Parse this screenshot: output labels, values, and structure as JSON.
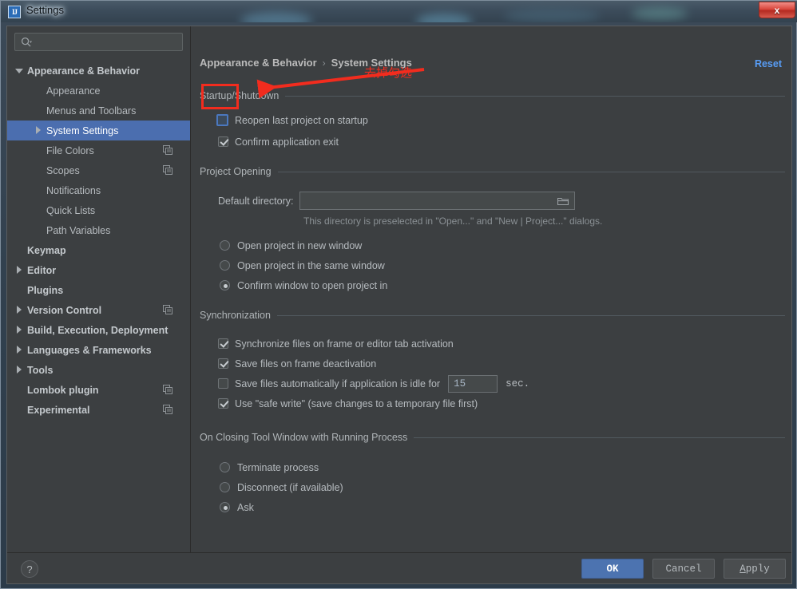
{
  "window": {
    "title": "Settings",
    "app_icon": "intellij-idea-icon",
    "close_label": "x"
  },
  "sidebar": {
    "search": {
      "value": "",
      "placeholder": ""
    },
    "items": [
      {
        "label": "Appearance & Behavior",
        "indent": 0,
        "twisty": "down",
        "bold": true,
        "selected": false,
        "copy": false
      },
      {
        "label": "Appearance",
        "indent": 1,
        "twisty": "none",
        "bold": false,
        "selected": false,
        "copy": false
      },
      {
        "label": "Menus and Toolbars",
        "indent": 1,
        "twisty": "none",
        "bold": false,
        "selected": false,
        "copy": false
      },
      {
        "label": "System Settings",
        "indent": 1,
        "twisty": "right",
        "bold": false,
        "selected": true,
        "copy": false
      },
      {
        "label": "File Colors",
        "indent": 1,
        "twisty": "none",
        "bold": false,
        "selected": false,
        "copy": true
      },
      {
        "label": "Scopes",
        "indent": 1,
        "twisty": "none",
        "bold": false,
        "selected": false,
        "copy": true
      },
      {
        "label": "Notifications",
        "indent": 1,
        "twisty": "none",
        "bold": false,
        "selected": false,
        "copy": false
      },
      {
        "label": "Quick Lists",
        "indent": 1,
        "twisty": "none",
        "bold": false,
        "selected": false,
        "copy": false
      },
      {
        "label": "Path Variables",
        "indent": 1,
        "twisty": "none",
        "bold": false,
        "selected": false,
        "copy": false
      },
      {
        "label": "Keymap",
        "indent": 0,
        "twisty": "none",
        "bold": true,
        "selected": false,
        "copy": false
      },
      {
        "label": "Editor",
        "indent": 0,
        "twisty": "right",
        "bold": true,
        "selected": false,
        "copy": false
      },
      {
        "label": "Plugins",
        "indent": 0,
        "twisty": "none",
        "bold": true,
        "selected": false,
        "copy": false
      },
      {
        "label": "Version Control",
        "indent": 0,
        "twisty": "right",
        "bold": true,
        "selected": false,
        "copy": true
      },
      {
        "label": "Build, Execution, Deployment",
        "indent": 0,
        "twisty": "right",
        "bold": true,
        "selected": false,
        "copy": false
      },
      {
        "label": "Languages & Frameworks",
        "indent": 0,
        "twisty": "right",
        "bold": true,
        "selected": false,
        "copy": false
      },
      {
        "label": "Tools",
        "indent": 0,
        "twisty": "right",
        "bold": true,
        "selected": false,
        "copy": false
      },
      {
        "label": "Lombok plugin",
        "indent": 0,
        "twisty": "none",
        "bold": true,
        "selected": false,
        "copy": true
      },
      {
        "label": "Experimental",
        "indent": 0,
        "twisty": "none",
        "bold": true,
        "selected": false,
        "copy": true
      }
    ]
  },
  "content": {
    "breadcrumb": {
      "parent": "Appearance & Behavior",
      "separator": "›",
      "current": "System Settings"
    },
    "reset_label": "Reset",
    "startup": {
      "title": "Startup/Shutdown",
      "reopen_last_project": {
        "label": "Reopen last project on startup",
        "checked": false
      },
      "confirm_exit": {
        "label": "Confirm application exit",
        "checked": true
      }
    },
    "project_opening": {
      "title": "Project Opening",
      "default_directory_label": "Default directory:",
      "default_directory_value": "",
      "browse_icon": "folder-icon",
      "hint": "This directory is preselected in \"Open...\" and \"New | Project...\" dialogs.",
      "options": [
        {
          "label": "Open project in new window",
          "selected": false
        },
        {
          "label": "Open project in the same window",
          "selected": false
        },
        {
          "label": "Confirm window to open project in",
          "selected": true
        }
      ]
    },
    "synchronization": {
      "title": "Synchronization",
      "items": [
        {
          "label": "Synchronize files on frame or editor tab activation",
          "checked": true
        },
        {
          "label": "Save files on frame deactivation",
          "checked": true
        },
        {
          "label": "Save files automatically if application is idle for",
          "checked": false
        },
        {
          "label": "Use \"safe write\" (save changes to a temporary file first)",
          "checked": true
        }
      ],
      "idle_seconds": "15",
      "idle_unit": "sec."
    },
    "on_closing": {
      "title": "On Closing Tool Window with Running Process",
      "options": [
        {
          "label": "Terminate process",
          "selected": false
        },
        {
          "label": "Disconnect (if available)",
          "selected": false
        },
        {
          "label": "Ask",
          "selected": true
        }
      ]
    }
  },
  "footer": {
    "help_label": "?",
    "ok_label": "OK",
    "cancel_label": "Cancel",
    "apply_label_prefix": "A",
    "apply_label_rest": "pply"
  },
  "annotation": {
    "text": "去掉勾选",
    "color": "#f22c1e"
  }
}
